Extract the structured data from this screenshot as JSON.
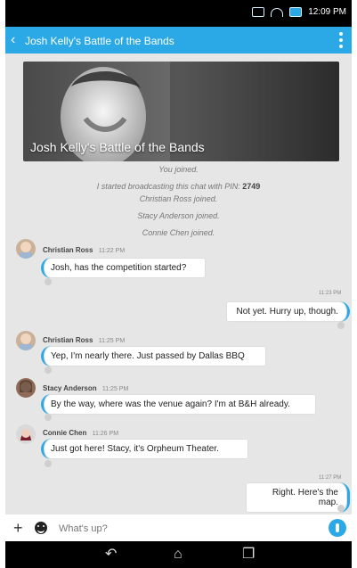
{
  "status_bar": {
    "time": "12:09 PM"
  },
  "header": {
    "title": "Josh Kelly's Battle of the Bands"
  },
  "hero": {
    "title": "Josh Kelly's Battle of the Bands"
  },
  "system_messages": [
    "You joined.",
    "I started broadcasting this chat with PIN:",
    "2749",
    "Christian Ross joined.",
    "Stacy Anderson joined.",
    "Connie Chen joined."
  ],
  "messages": [
    {
      "sender": "Christian Ross",
      "time": "11:22 PM",
      "text": "Josh, has the competition started?"
    },
    {
      "sender": "",
      "time": "11:23 PM",
      "text": "Not yet. Hurry up, though."
    },
    {
      "sender": "Christian Ross",
      "time": "11:25 PM",
      "text": "Yep, I'm nearly there. Just passed by Dallas BBQ"
    },
    {
      "sender": "Stacy Anderson",
      "time": "11:25 PM",
      "text": "By the way, where was the venue again? I'm at B&H already."
    },
    {
      "sender": "Connie Chen",
      "time": "11:26 PM",
      "text": "Just got here! Stacy, it's Orpheum Theater."
    },
    {
      "sender": "",
      "time": "11:27 PM",
      "text": "Right. Here's the map."
    }
  ],
  "composer": {
    "placeholder": "What's up?"
  },
  "icons": {
    "back": "back-icon",
    "more": "more-vert-icon",
    "plus": "plus-icon",
    "emoji": "emoji-icon",
    "send": "send-icon",
    "nav_back": "back-arrow-icon",
    "nav_home": "home-icon",
    "nav_recent": "recent-apps-icon"
  },
  "colors": {
    "accent": "#2aa9e6",
    "background": "#e6e6e6"
  }
}
